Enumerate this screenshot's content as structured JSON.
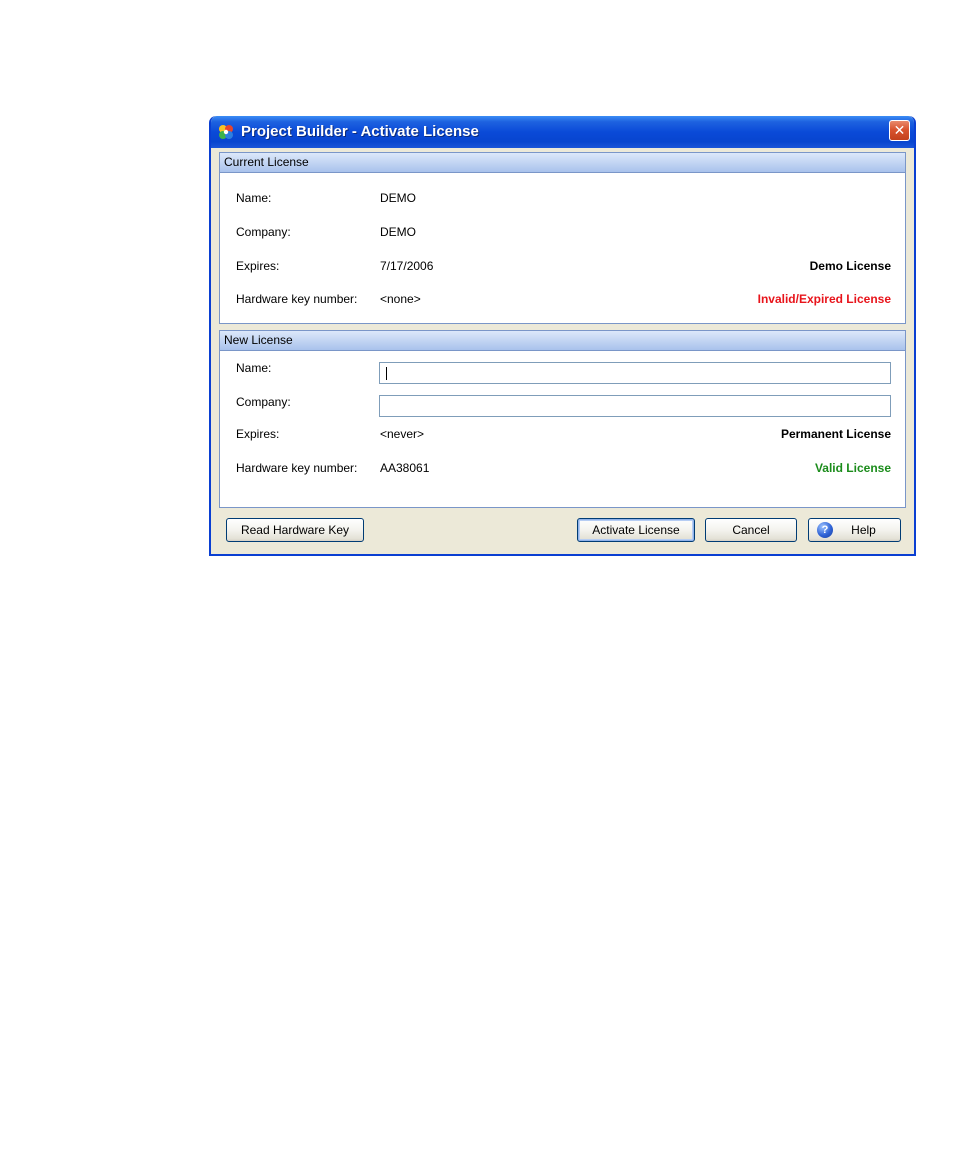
{
  "window": {
    "title": "Project Builder - Activate License",
    "close_glyph": "✕",
    "icon": "app-icon"
  },
  "current_license": {
    "header": "Current License",
    "name_label": "Name:",
    "name_value": "DEMO",
    "company_label": "Company:",
    "company_value": "DEMO",
    "expires_label": "Expires:",
    "expires_value": "7/17/2006",
    "license_type": "Demo License",
    "hwkey_label": "Hardware key number:",
    "hwkey_value": "<none>",
    "status": "Invalid/Expired License",
    "status_color": "#e8141b"
  },
  "new_license": {
    "header": "New License",
    "name_label": "Name:",
    "name_input_value": "",
    "company_label": "Company:",
    "company_input_value": "",
    "expires_label": "Expires:",
    "expires_value": "<never>",
    "license_type": "Permanent License",
    "hwkey_label": "Hardware key number:",
    "hwkey_value": "AA38061",
    "status": "Valid License",
    "status_color": "#1b8c1b"
  },
  "buttons": {
    "read_hardware_key": "Read Hardware Key",
    "activate_license": "Activate License",
    "cancel": "Cancel",
    "help": "Help",
    "help_icon": "help-icon"
  }
}
